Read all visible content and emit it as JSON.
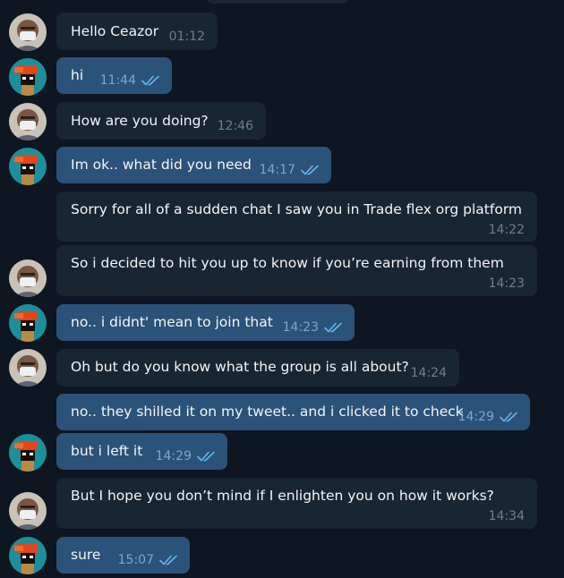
{
  "chat": {
    "messages": [
      {
        "text": "Hello Ceazor",
        "time": "01:12",
        "dir": "in"
      },
      {
        "text": "hi",
        "time": "11:44",
        "dir": "out",
        "read": true
      },
      {
        "text": "How are you doing?",
        "time": "12:46",
        "dir": "in"
      },
      {
        "text": "Im ok.. what did you need",
        "time": "14:17",
        "dir": "out",
        "read": true
      },
      {
        "text": "Sorry for all of a sudden chat I saw you in Trade flex org platform",
        "time": "14:22",
        "dir": "in"
      },
      {
        "text": "So i decided to hit you up to know if you’re earning from them",
        "time": "14:23",
        "dir": "in"
      },
      {
        "text": "no.. i didnt' mean to join that",
        "time": "14:23",
        "dir": "out",
        "read": true
      },
      {
        "text": "Oh but do you know what the group is all about?",
        "time": "14:24",
        "dir": "in"
      },
      {
        "text": "no.. they shilled it on my tweet.. and i clicked it to check",
        "time": "14:29",
        "dir": "out",
        "read": true
      },
      {
        "text": "but i left it",
        "time": "14:29",
        "dir": "out",
        "read": true
      },
      {
        "text": "But I hope you don’t mind if I enlighten you on how it works?",
        "time": "14:34",
        "dir": "in"
      },
      {
        "text": "sure",
        "time": "15:07",
        "dir": "out",
        "read": true
      }
    ]
  },
  "icons": {
    "read_receipt": "double-check-icon",
    "contact_avatar": "avatar-masked-person",
    "user_avatar": "avatar-pixel-art"
  },
  "colors": {
    "background": "#0e1621",
    "incoming_bubble": "#182533",
    "outgoing_bubble": "#2b5278",
    "read_check": "#64b5ef",
    "time_in": "#6d7f8f",
    "time_out": "#7da8d3"
  }
}
